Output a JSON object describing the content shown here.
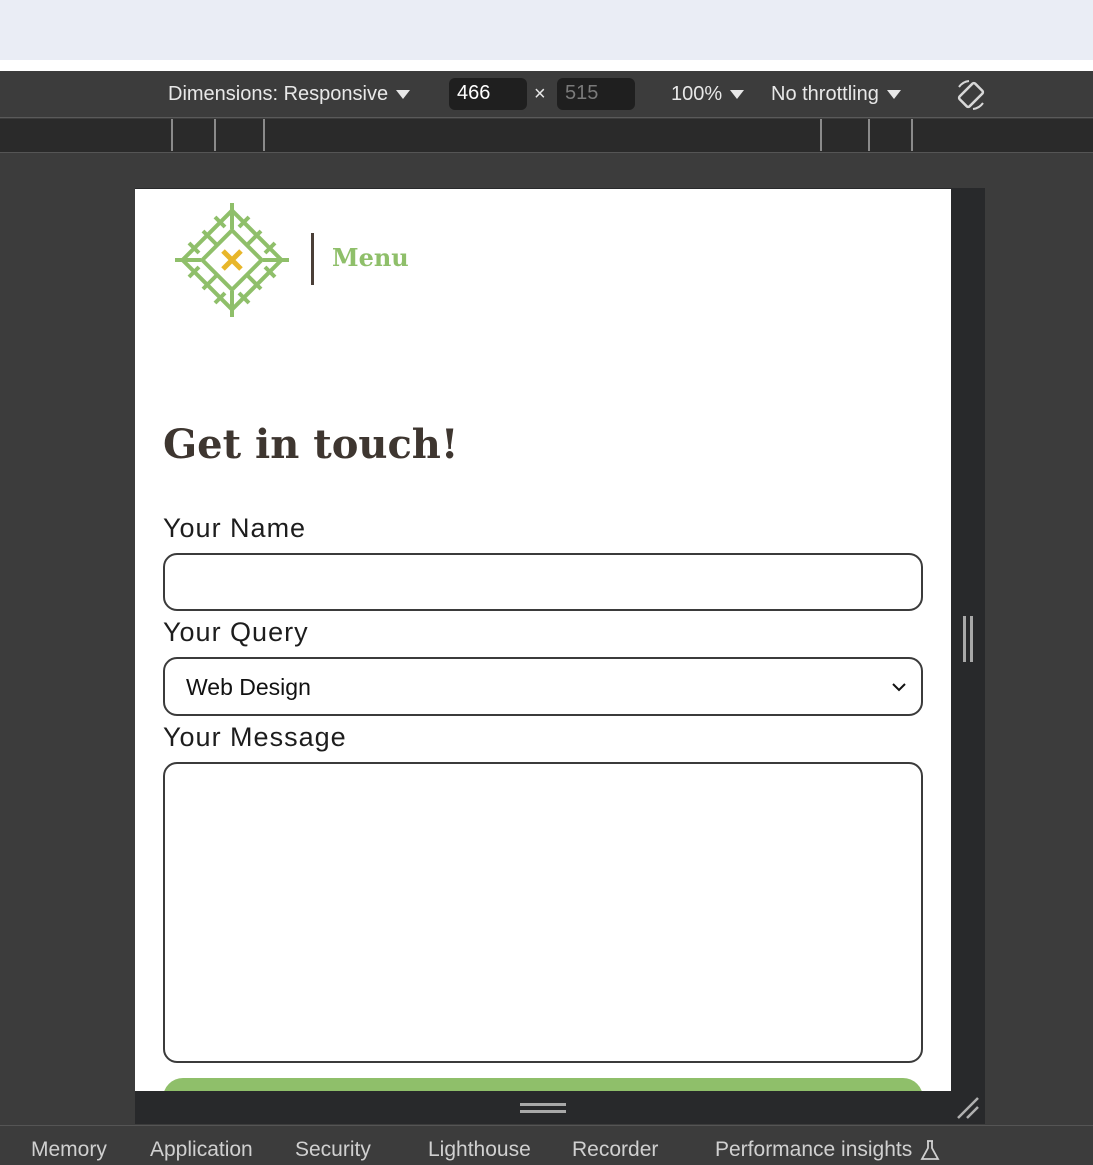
{
  "devtools": {
    "toolbar": {
      "dimensions_label": "Dimensions: Responsive",
      "width_value": "466",
      "height_placeholder": "515",
      "times_symbol": "×",
      "zoom_label": "100%",
      "throttling_label": "No throttling"
    },
    "tabs": [
      "Memory",
      "Application",
      "Security",
      "Lighthouse",
      "Recorder",
      "Performance insights"
    ]
  },
  "page": {
    "menu_label": "Menu",
    "heading": "Get in touch!",
    "form": {
      "name_label": "Your Name",
      "name_value": "",
      "query_label": "Your Query",
      "query_selected": "Web Design",
      "message_label": "Your Message",
      "message_value": ""
    }
  },
  "colors": {
    "accent_green": "#8fbf6a",
    "logo_center": "#e8b62a",
    "heading_brown": "#3e3630"
  }
}
